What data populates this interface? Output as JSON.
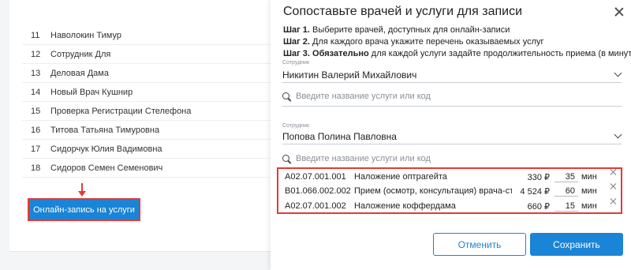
{
  "background": {
    "employees": [
      {
        "num": "11",
        "name": "Наволокин Тимур"
      },
      {
        "num": "12",
        "name": "Сотрудник Для"
      },
      {
        "num": "13",
        "name": "Деловая Дама"
      },
      {
        "num": "14",
        "name": "Новый Врач Кушнир"
      },
      {
        "num": "15",
        "name": "Проверка Регистрации Стелефона"
      },
      {
        "num": "16",
        "name": "Титова Татьяна Тимуровна"
      },
      {
        "num": "17",
        "name": "Сидорчук Юлия Вадимовна"
      },
      {
        "num": "18",
        "name": "Сидоров Семен Семенович"
      }
    ],
    "online_button_label": "Онлайн-запись на услуги",
    "accent_color": "#1a84d6",
    "highlight_color": "#e53935"
  },
  "modal": {
    "title": "Сопоставьте врачей и услуги для записи",
    "steps": {
      "s1_bold": "Шаг 1.",
      "s1_text": " Выберите врачей, доступных для онлайн-записи",
      "s2_bold": "Шаг 2.",
      "s2_text": " Для каждого врача укажите перечень оказываемых услуг",
      "s3_bold": "Шаг 3. Обязательно",
      "s3_text": " для каждой услуги задайте продолжительность приема (в минутах)"
    },
    "doctors": [
      {
        "field_label": "Сотрудник",
        "value": "Никитин Валерий Михайлович",
        "search_placeholder": "Введите название услуги или код"
      },
      {
        "field_label": "Сотрудник",
        "value": "Попова Полина Павловна",
        "search_placeholder": "Введите название услуги или код"
      }
    ],
    "services": [
      {
        "code": "A02.07.001.001",
        "name": "Наложение оптрагейта",
        "price": "330 ₽",
        "duration": "35",
        "unit": "мин"
      },
      {
        "code": "B01.066.002.002",
        "name": "Прием (осмотр, консультация) врача-стома...",
        "price": "4 524 ₽",
        "duration": "60",
        "unit": "мин"
      },
      {
        "code": "A02.07.001.002",
        "name": "Наложение коффердама",
        "price": "660 ₽",
        "duration": "15",
        "unit": "мин"
      }
    ],
    "cancel_label": "Отменить",
    "save_label": "Сохранить"
  }
}
